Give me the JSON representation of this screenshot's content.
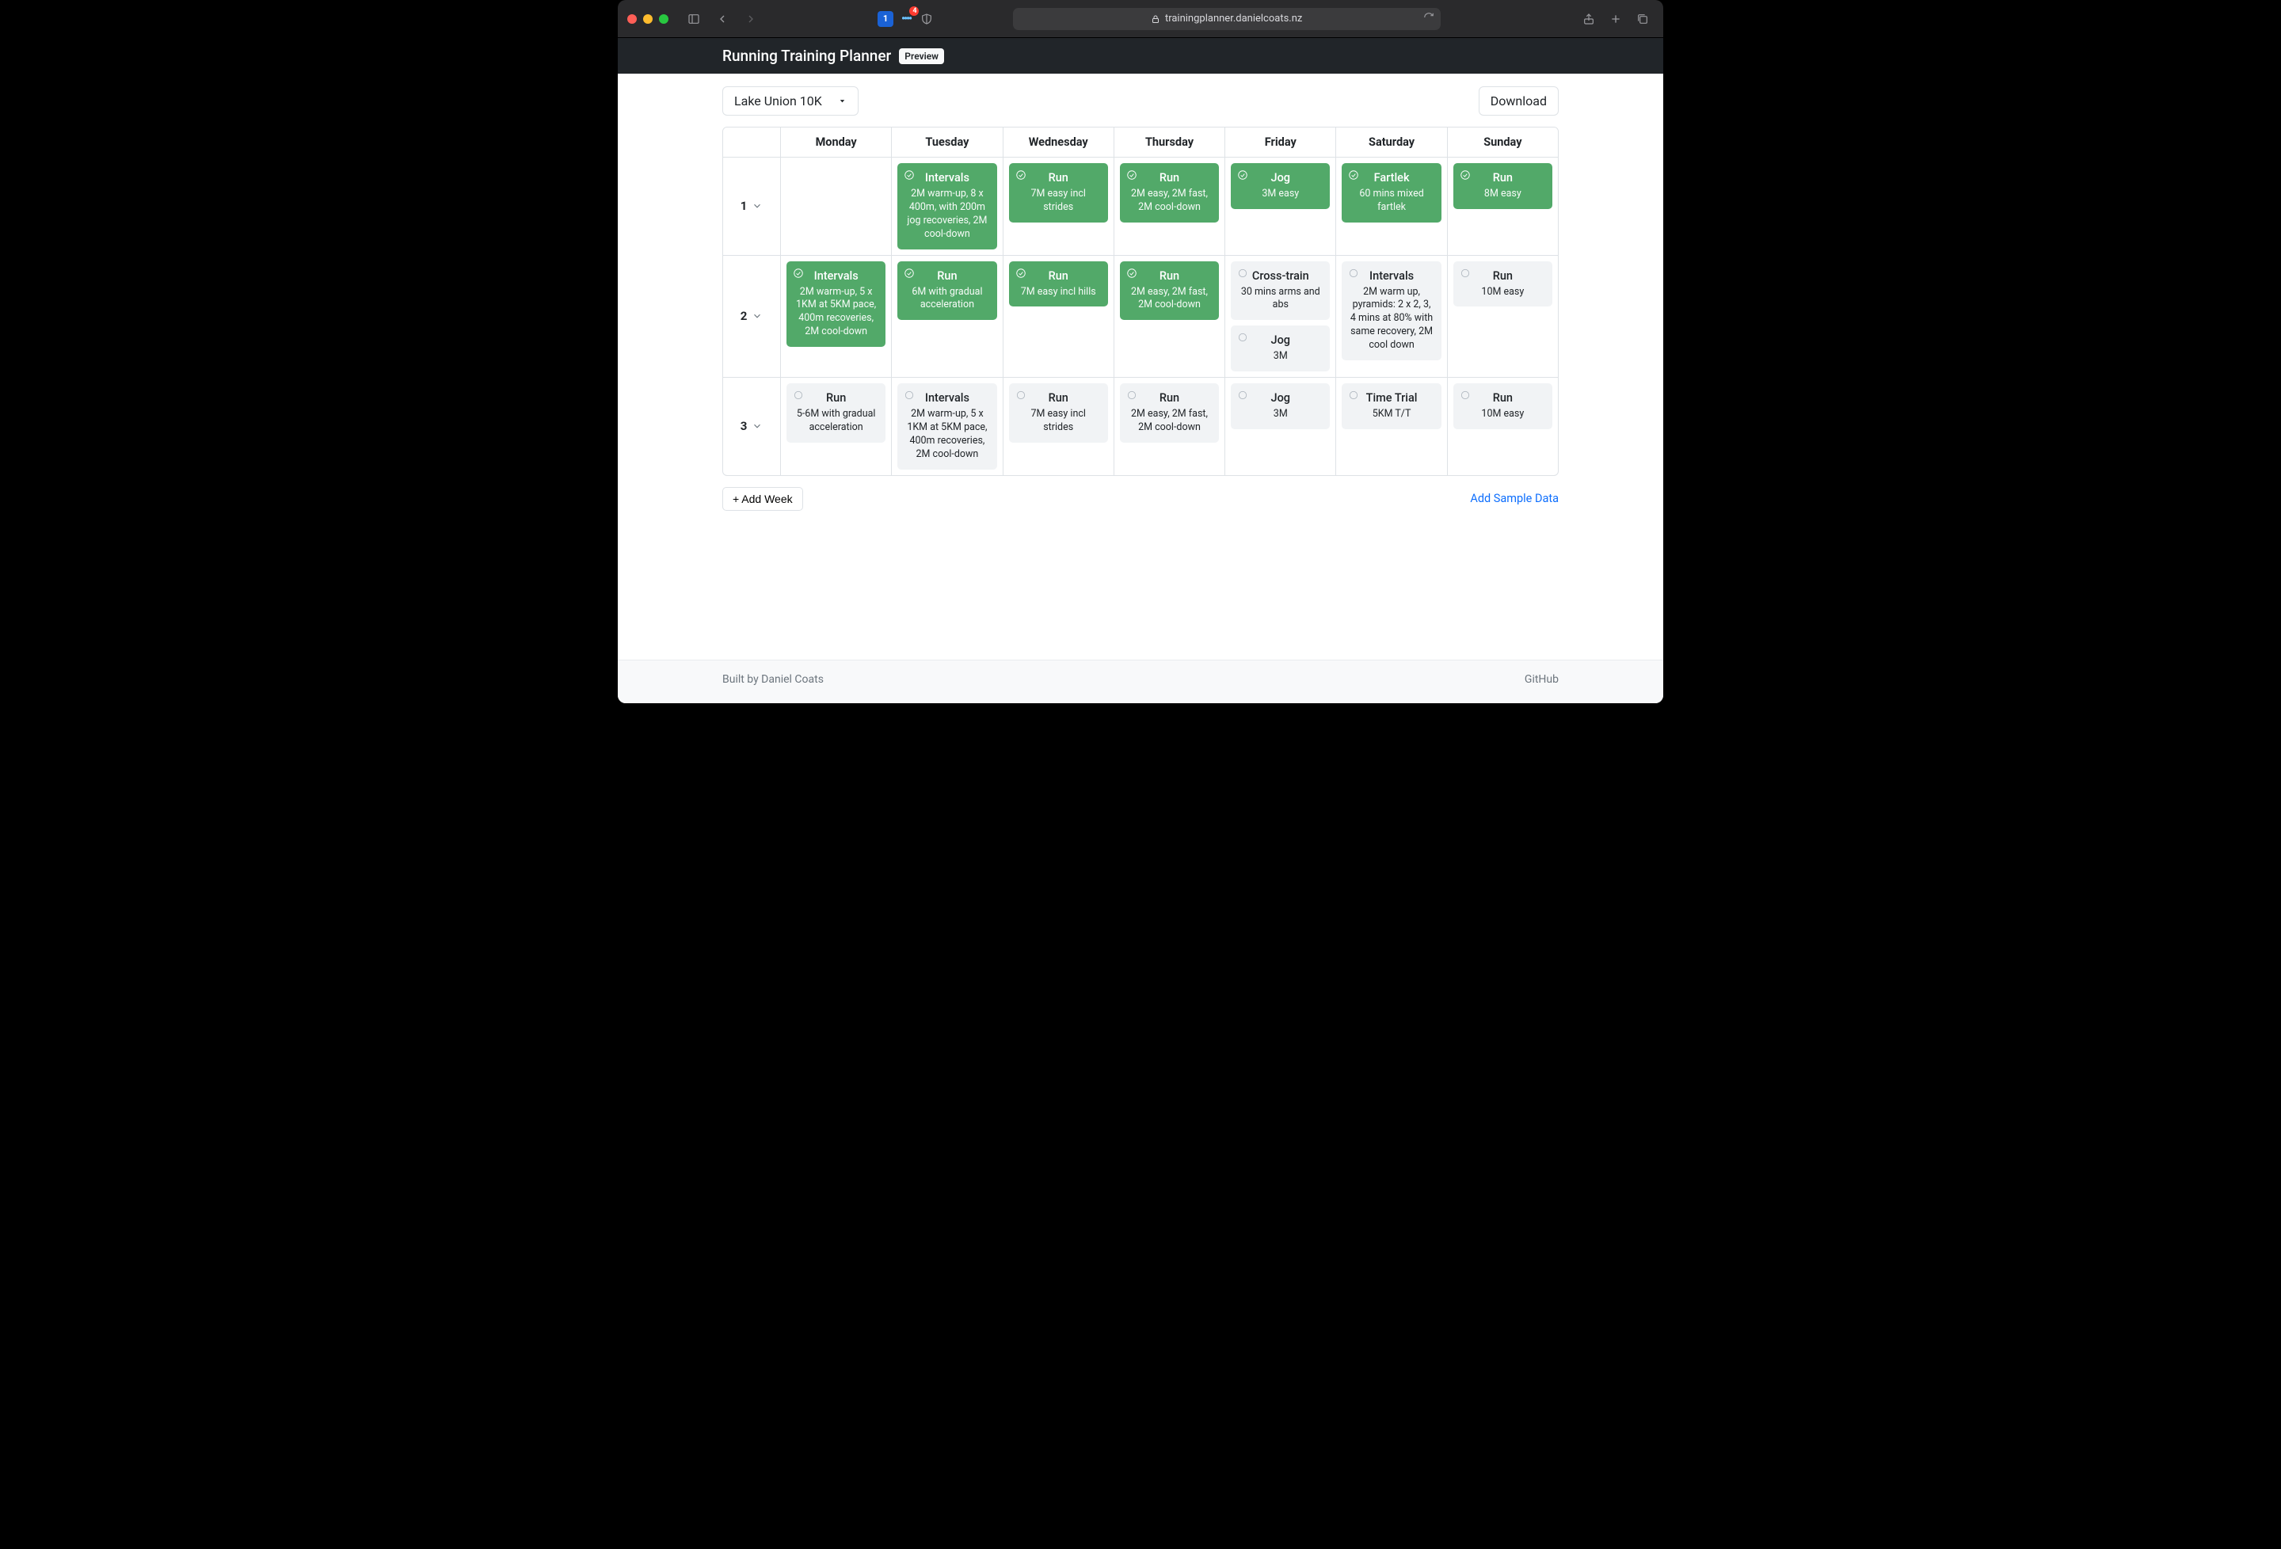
{
  "browser": {
    "url": "trainingplanner.danielcoats.nz",
    "ext_badge": "4"
  },
  "header": {
    "title": "Running Training Planner",
    "badge": "Preview"
  },
  "controls": {
    "plan_name": "Lake Union 10K",
    "download_label": "Download"
  },
  "days": [
    "Monday",
    "Tuesday",
    "Wednesday",
    "Thursday",
    "Friday",
    "Saturday",
    "Sunday"
  ],
  "weeks": [
    {
      "num": "1",
      "days": [
        [],
        [
          {
            "done": true,
            "title": "Intervals",
            "desc": "2M warm-up, 8 x 400m, with 200m jog recoveries, 2M cool-down"
          }
        ],
        [
          {
            "done": true,
            "title": "Run",
            "desc": "7M easy incl strides"
          }
        ],
        [
          {
            "done": true,
            "title": "Run",
            "desc": "2M easy, 2M fast, 2M cool-down"
          }
        ],
        [
          {
            "done": true,
            "title": "Jog",
            "desc": "3M easy"
          }
        ],
        [
          {
            "done": true,
            "title": "Fartlek",
            "desc": "60 mins mixed fartlek"
          }
        ],
        [
          {
            "done": true,
            "title": "Run",
            "desc": "8M easy"
          }
        ]
      ]
    },
    {
      "num": "2",
      "days": [
        [
          {
            "done": true,
            "title": "Intervals",
            "desc": "2M warm-up, 5 x 1KM at 5KM pace, 400m recoveries, 2M cool-down"
          }
        ],
        [
          {
            "done": true,
            "title": "Run",
            "desc": "6M with gradual acceleration"
          }
        ],
        [
          {
            "done": true,
            "title": "Run",
            "desc": "7M easy incl hills"
          }
        ],
        [
          {
            "done": true,
            "title": "Run",
            "desc": "2M easy, 2M fast, 2M cool-down"
          }
        ],
        [
          {
            "done": false,
            "title": "Cross-train",
            "desc": "30 mins arms and abs"
          },
          {
            "done": false,
            "title": "Jog",
            "desc": "3M"
          }
        ],
        [
          {
            "done": false,
            "title": "Intervals",
            "desc": "2M warm up, pyramids: 2 x 2, 3, 4 mins at 80% with same recovery, 2M cool down"
          }
        ],
        [
          {
            "done": false,
            "title": "Run",
            "desc": "10M easy"
          }
        ]
      ]
    },
    {
      "num": "3",
      "days": [
        [
          {
            "done": false,
            "title": "Run",
            "desc": "5-6M with gradual acceleration"
          }
        ],
        [
          {
            "done": false,
            "title": "Intervals",
            "desc": "2M warm-up, 5 x 1KM at 5KM pace, 400m recoveries, 2M cool-down"
          }
        ],
        [
          {
            "done": false,
            "title": "Run",
            "desc": "7M easy incl strides"
          }
        ],
        [
          {
            "done": false,
            "title": "Run",
            "desc": "2M easy, 2M fast, 2M cool-down"
          }
        ],
        [
          {
            "done": false,
            "title": "Jog",
            "desc": "3M"
          }
        ],
        [
          {
            "done": false,
            "title": "Time Trial",
            "desc": "5KM T/T"
          }
        ],
        [
          {
            "done": false,
            "title": "Run",
            "desc": "10M easy"
          }
        ]
      ]
    }
  ],
  "actions": {
    "add_week": "+ Add Week",
    "add_sample": "Add Sample Data"
  },
  "footer": {
    "built_by": "Built by Daniel Coats",
    "github": "GitHub"
  }
}
